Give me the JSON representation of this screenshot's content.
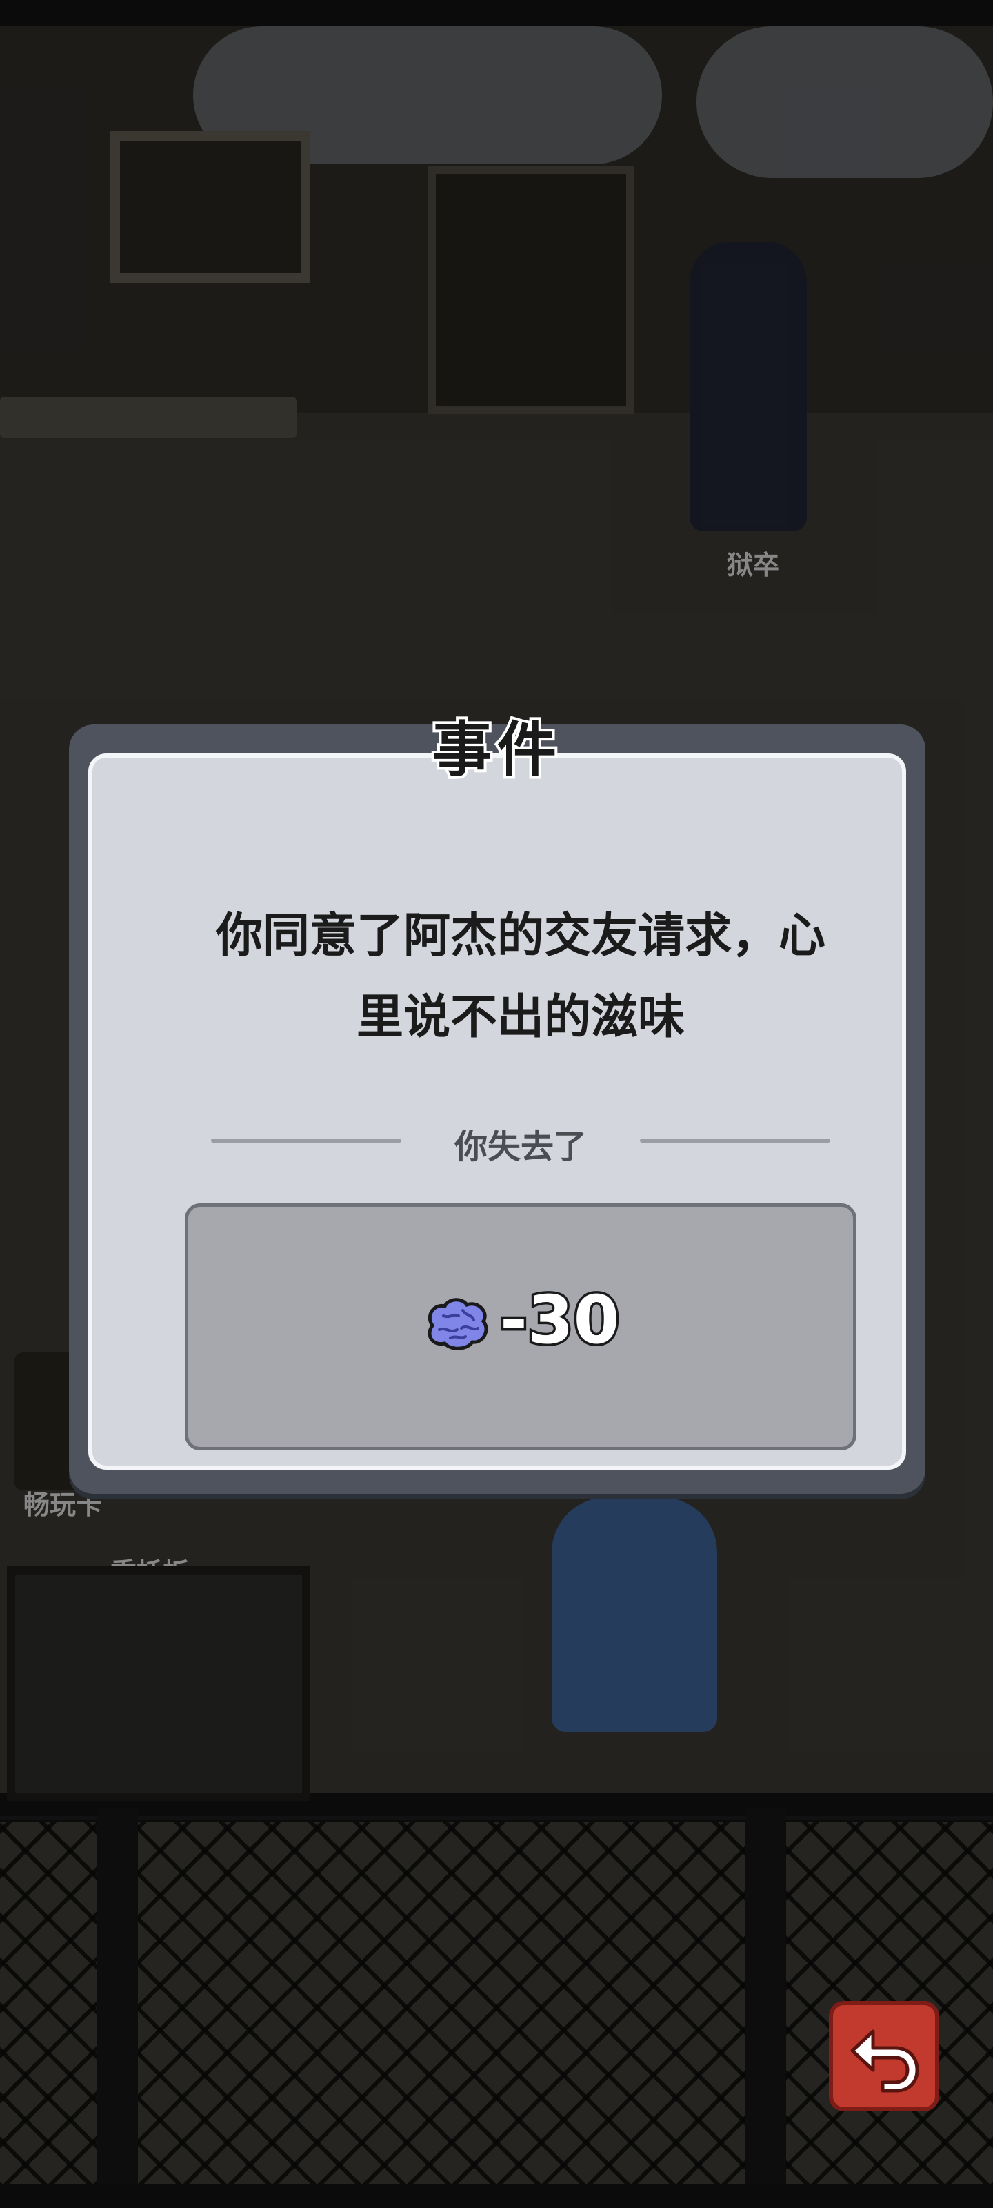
{
  "dialog": {
    "title": "事件",
    "message_line1": "你同意了阿杰的交友请求，心",
    "message_line2": "里说不出的滋味",
    "lose_label": "你失去了",
    "reward": {
      "icon": "brain-icon",
      "value": "-30"
    }
  },
  "scene": {
    "guard_label": "狱卒",
    "vip_label": "畅玩卡",
    "board_label": "委托板"
  },
  "buttons": {
    "back_icon": "return-arrow-icon"
  },
  "colors": {
    "accent_red": "#c23a2e",
    "dialog_bg": "#d3d6dd",
    "brain": "#7f86e8"
  }
}
